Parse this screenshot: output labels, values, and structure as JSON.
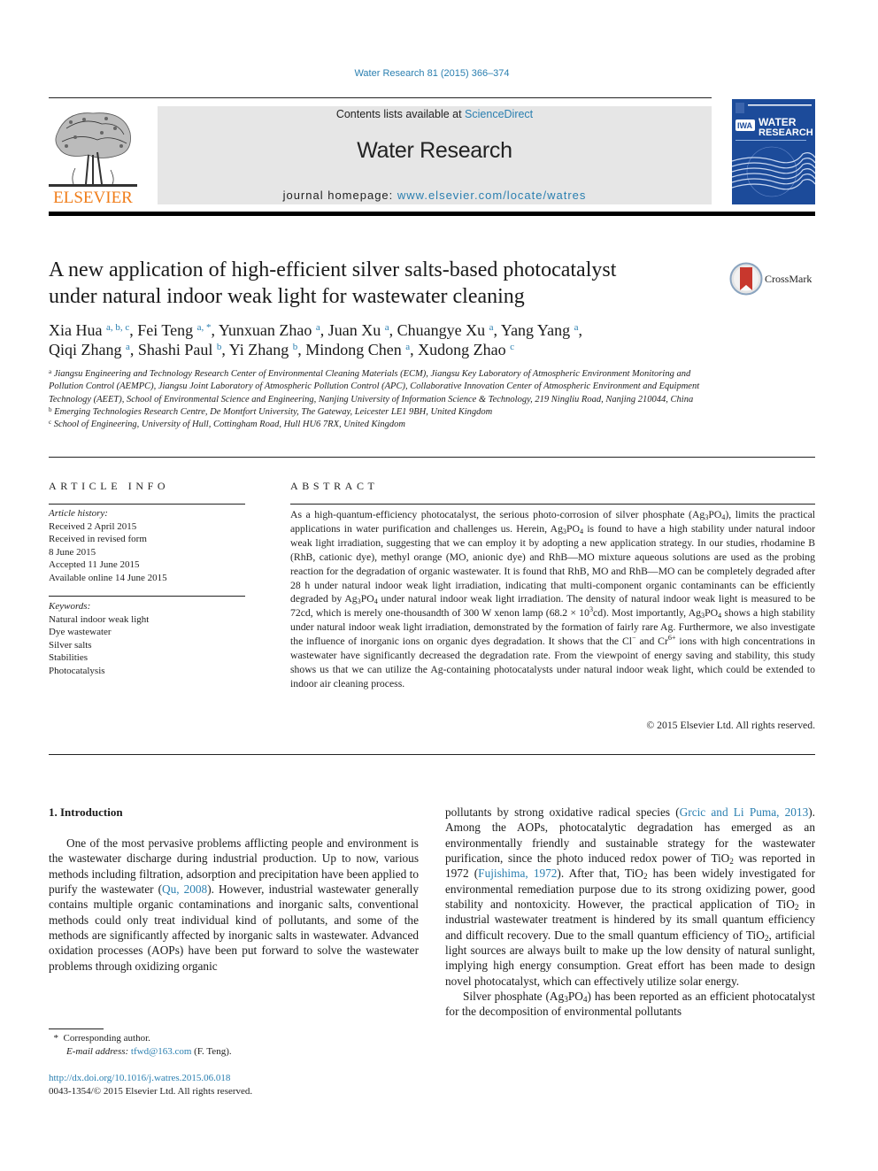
{
  "journal_ref": "Water Research 81 (2015) 366–374",
  "masthead": {
    "publisher_logo_text": "ELSEVIER",
    "contents_prefix": "Contents lists available at ",
    "contents_link": "ScienceDirect",
    "journal_title": "Water Research",
    "homepage_prefix": "journal homepage: ",
    "homepage_link": "www.elsevier.com/locate/watres",
    "cover_title_line1": "WATER",
    "cover_title_line2": "RESEARCH",
    "cover_badge": "IWA"
  },
  "colors": {
    "link": "#2a7fb0",
    "elsevier_orange": "#f07d1a",
    "masthead_gray": "#e6e6e6",
    "cover_blue": "#1c4b9a",
    "crossmark_red": "#c8372d"
  },
  "article": {
    "title_line1": "A new application of high-efficient silver salts-based photocatalyst",
    "title_line2": "under natural indoor weak light for wastewater cleaning",
    "crossmark_label": "CrossMark",
    "authors": [
      {
        "name": "Xia Hua",
        "aff": "a, b, c",
        "sep": ", "
      },
      {
        "name": "Fei Teng",
        "aff": "a, *",
        "sep": ", "
      },
      {
        "name": "Yunxuan Zhao",
        "aff": "a",
        "sep": ", "
      },
      {
        "name": "Juan Xu",
        "aff": "a",
        "sep": ", "
      },
      {
        "name": "Chuangye Xu",
        "aff": "a",
        "sep": ", "
      },
      {
        "name": "Yang Yang",
        "aff": "a",
        "sep": ","
      },
      {
        "name": "Qiqi Zhang",
        "aff": "a",
        "sep": ", "
      },
      {
        "name": "Shashi Paul",
        "aff": "b",
        "sep": ", "
      },
      {
        "name": "Yi Zhang",
        "aff": "b",
        "sep": ", "
      },
      {
        "name": "Mindong Chen",
        "aff": "a",
        "sep": ", "
      },
      {
        "name": "Xudong Zhao",
        "aff": "c",
        "sep": ""
      }
    ],
    "affiliations": [
      {
        "key": "a",
        "text": "Jiangsu Engineering and Technology Research Center of Environmental Cleaning Materials (ECM), Jiangsu Key Laboratory of Atmospheric Environment Monitoring and Pollution Control (AEMPC), Jiangsu Joint Laboratory of Atmospheric Pollution Control (APC), Collaborative Innovation Center of Atmospheric Environment and Equipment Technology (AEET), School of Environmental Science and Engineering, Nanjing University of Information Science & Technology, 219 Ningliu Road, Nanjing 210044, China"
      },
      {
        "key": "b",
        "text": "Emerging Technologies Research Centre, De Montfort University, The Gateway, Leicester LE1 9BH, United Kingdom"
      },
      {
        "key": "c",
        "text": "School of Engineering, University of Hull, Cottingham Road, Hull HU6 7RX, United Kingdom"
      }
    ]
  },
  "article_info": {
    "heading": "ARTICLE INFO",
    "history_label": "Article history:",
    "history": [
      "Received 2 April 2015",
      "Received in revised form",
      "8 June 2015",
      "Accepted 11 June 2015",
      "Available online 14 June 2015"
    ],
    "keywords_label": "Keywords:",
    "keywords": [
      "Natural indoor weak light",
      "Dye wastewater",
      "Silver salts",
      "Stabilities",
      "Photocatalysis"
    ]
  },
  "abstract": {
    "heading": "ABSTRACT",
    "segments": {
      "s1": "As a high-quantum-efficiency photocatalyst, the serious photo-corrosion of silver phosphate (Ag",
      "s2": "PO",
      "s3": "), limits the practical applications in water purification and challenges us. Herein, Ag",
      "s4": "PO",
      "s5": " is found to have a high stability under natural indoor weak light irradiation, suggesting that we can employ it by adopting a new application strategy. In our studies, rhodamine B (RhB, cationic dye), methyl orange (MO, anionic dye) and RhB—MO mixture aqueous solutions are used as the probing reaction for the degradation of organic wastewater. It is found that RhB, MO and RhB—MO can be completely degraded after 28 h under natural indoor weak light irradiation, indicating that multi-component organic contaminants can be efficiently degraded by Ag",
      "s6": "PO",
      "s7": " under natural indoor weak light irradiation. The density of natural indoor weak light is measured to be 72cd, which is merely one-thousandth of 300 W xenon lamp (68.2 × 10",
      "s8": "cd). Most importantly, Ag",
      "s9": "PO",
      "s10": " shows a high stability under natural indoor weak light irradiation, demon­strated by the formation of fairly rare Ag. Furthermore, we also investigate the influence of inorganic ions on organic dyes degradation. It shows that the Cl",
      "s11": " and Cr",
      "s12": " ions with high concentrations in wastewater have significantly decreased the degradation rate. From the viewpoint of energy saving and stability, this study shows us that we can utilize the Ag-containing photocatalysts under natural indoor weak light, which could be extended to indoor air cleaning process.",
      "sub3": "3",
      "sub4": "4",
      "sup3": "3",
      "sup_minus": "−",
      "sup_6plus": "6+"
    },
    "copyright": "© 2015 Elsevier Ltd. All rights reserved."
  },
  "introduction": {
    "heading": "1.  Introduction",
    "left": {
      "p1a": "One of the most pervasive problems afflicting people and environment is the wastewater discharge during industrial pro­duction. Up to now, various methods including filtration, adsorp­tion and precipitation have been applied to purify the wastewater (",
      "cite1": "Qu, 2008",
      "p1b": "). However, industrial wastewater generally contains multiple organic contaminations and inorganic salts, conventional methods could only treat individual kind of pollutants, and some of the methods are significantly affected by inorganic salts in waste­water. Advanced oxidation processes (AOPs) have been put forward to solve the wastewater problems through oxidizing organic"
    },
    "right": {
      "p1a": "pollutants by strong oxidative radical species (",
      "cite2": "Grcic and Li Puma, 2013",
      "p1b": "). Among the AOPs, photocatalytic degradation has emerged as an environmentally friendly and sustainable strategy for the wastewater purification, since the photo induced redox power of TiO",
      "p1c": " was reported in 1972 (",
      "cite3": "Fujishima, 1972",
      "p1d": "). After that, TiO",
      "p1e": " has been widely investigated for environmental remediation purpose due to its strong oxidizing power, good stability and nontoxicity. However, the practical application of TiO",
      "p1f": " in industrial wastewater treatment is hindered by its small quantum efficiency and difficult recovery. Due to the small quantum efficiency of TiO",
      "p1g": ", artificial light sources are always built to make up the low density of natural sunlight, implying high energy consumption. Great effort has been made to design novel photocatalyst, which can effectively utilize solar energy.",
      "p2a": "Silver phosphate (Ag",
      "p2b": "PO",
      "p2c": ") has been reported as an efficient photocatalyst for the decomposition of environmental pollutants",
      "sub2": "2",
      "sub3": "3",
      "sub4": "4"
    }
  },
  "footnotes": {
    "star": "*",
    "corresponding": "Corresponding author.",
    "email_label": "E-mail address:",
    "email": "tfwd@163.com",
    "email_suffix": " (F. Teng).",
    "doi": "http://dx.doi.org/10.1016/j.watres.2015.06.018",
    "issn_line": "0043-1354/© 2015 Elsevier Ltd. All rights reserved."
  }
}
